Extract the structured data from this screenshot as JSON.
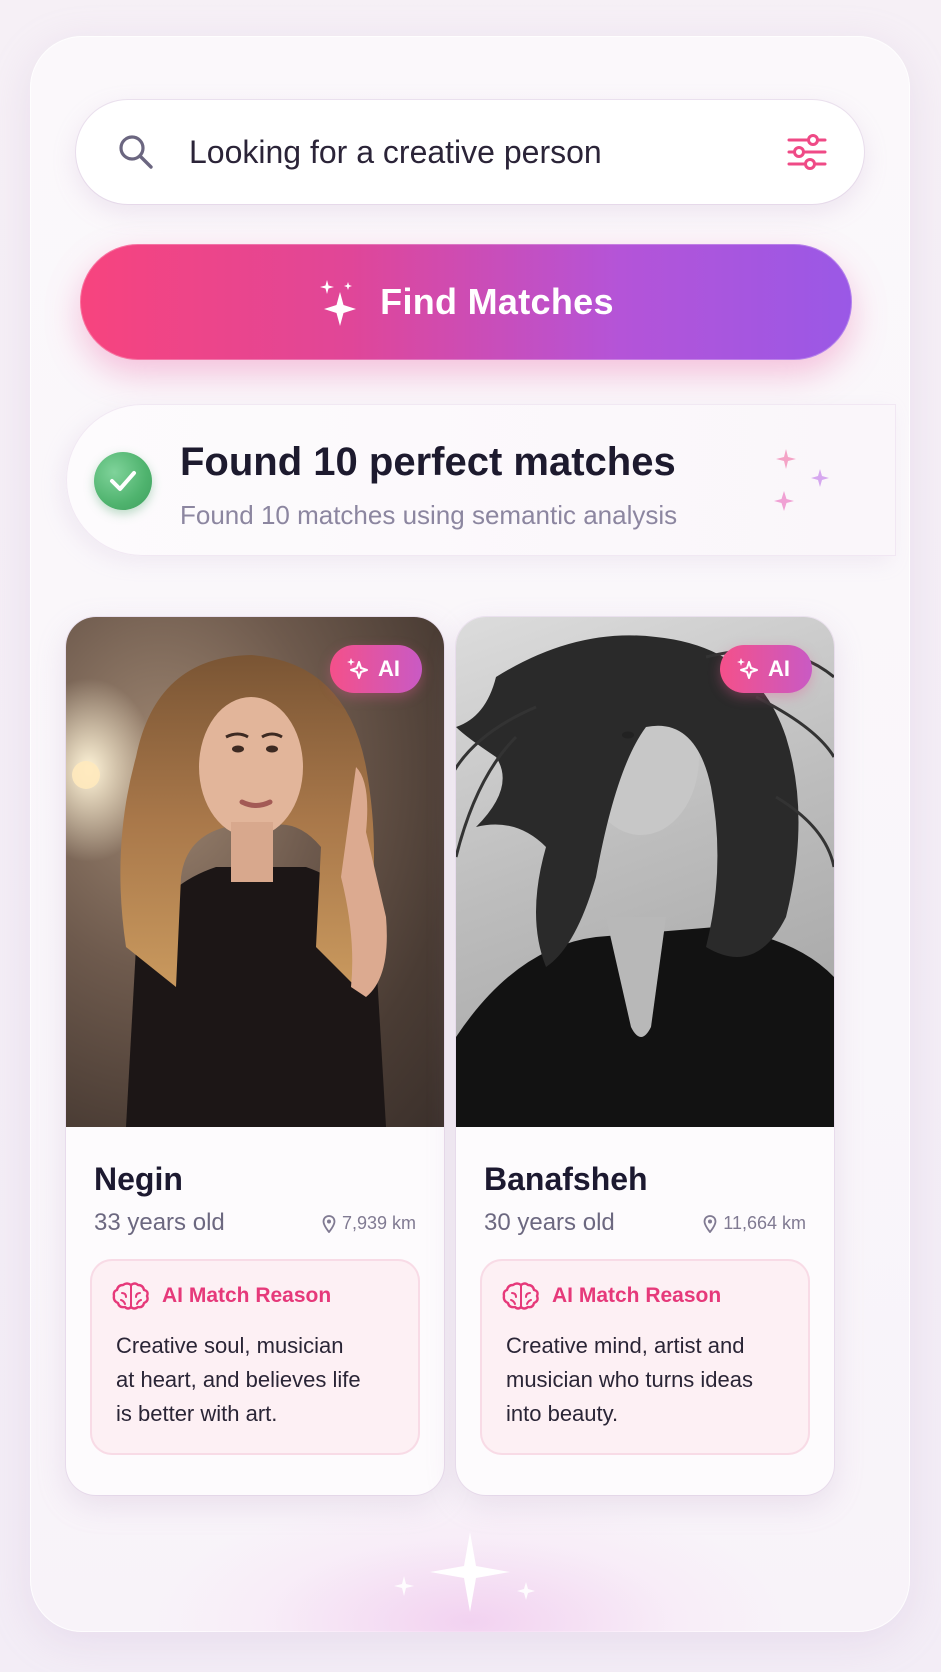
{
  "search": {
    "query": "Looking for a creative person",
    "search_icon": "search-icon",
    "filter_icon": "sliders-icon"
  },
  "find_button": {
    "label": "Find Matches",
    "icon": "sparkles-icon"
  },
  "status": {
    "title": "Found 10 perfect matches",
    "subtitle": "Found 10 matches using semantic analysis",
    "icon": "check-circle-icon"
  },
  "matches": [
    {
      "name": "Negin",
      "age": "33 years old",
      "distance": "7,939 km",
      "badge": "AI",
      "reason_title": "AI Match Reason",
      "reason_text": "Creative soul, musician at heart, and believes life is better with art."
    },
    {
      "name": "Banafsheh",
      "age": "30 years old",
      "distance": "11,664 km",
      "badge": "AI",
      "reason_title": "AI Match Reason",
      "reason_text": "Creative mind, artist and musician who turns ideas into beauty."
    }
  ],
  "colors": {
    "accent_pink": "#f7447e",
    "accent_purple": "#9a58e6",
    "success_green": "#4fb36e",
    "reason_pink": "#e6397a"
  }
}
